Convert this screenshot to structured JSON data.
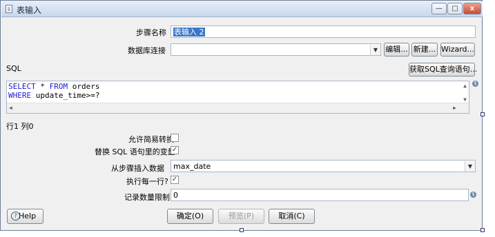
{
  "window": {
    "title": "表输入",
    "min": "—",
    "max": "□",
    "close": "x"
  },
  "form": {
    "step_name_label": "步骤名称",
    "step_name_value": "表输入 2",
    "db_conn_label": "数据库连接",
    "db_conn_value": "",
    "edit_btn": "编辑...",
    "new_btn": "新建...",
    "wizard_btn": "Wizard...",
    "sql_label": "SQL",
    "get_sql_btn": "获取SQL查询语句...",
    "sql": {
      "l1_kw1": "SELECT",
      "l1_mid": " * ",
      "l1_kw2": "FROM",
      "l1_rest": " orders",
      "l2_kw": "WHERE",
      "l2_rest": " update_time>=?"
    },
    "position": "行1 列0",
    "lazy_label": "允许简易转换",
    "lazy_checked": false,
    "replace_vars_label": "替换 SQL 语句里的变量",
    "replace_vars_checked": true,
    "insert_from_label": "从步骤插入数据",
    "insert_from_value": "max_date",
    "each_row_label": "执行每一行?",
    "each_row_checked": true,
    "limit_label": "记录数量限制",
    "limit_value": "0"
  },
  "buttons": {
    "help": "Help",
    "ok": "确定(O)",
    "preview": "预览(P)",
    "cancel": "取消(C)"
  },
  "icons": {
    "var_icon": "$",
    "help_icon": "?",
    "check": "✓",
    "dropdown": "▼"
  }
}
